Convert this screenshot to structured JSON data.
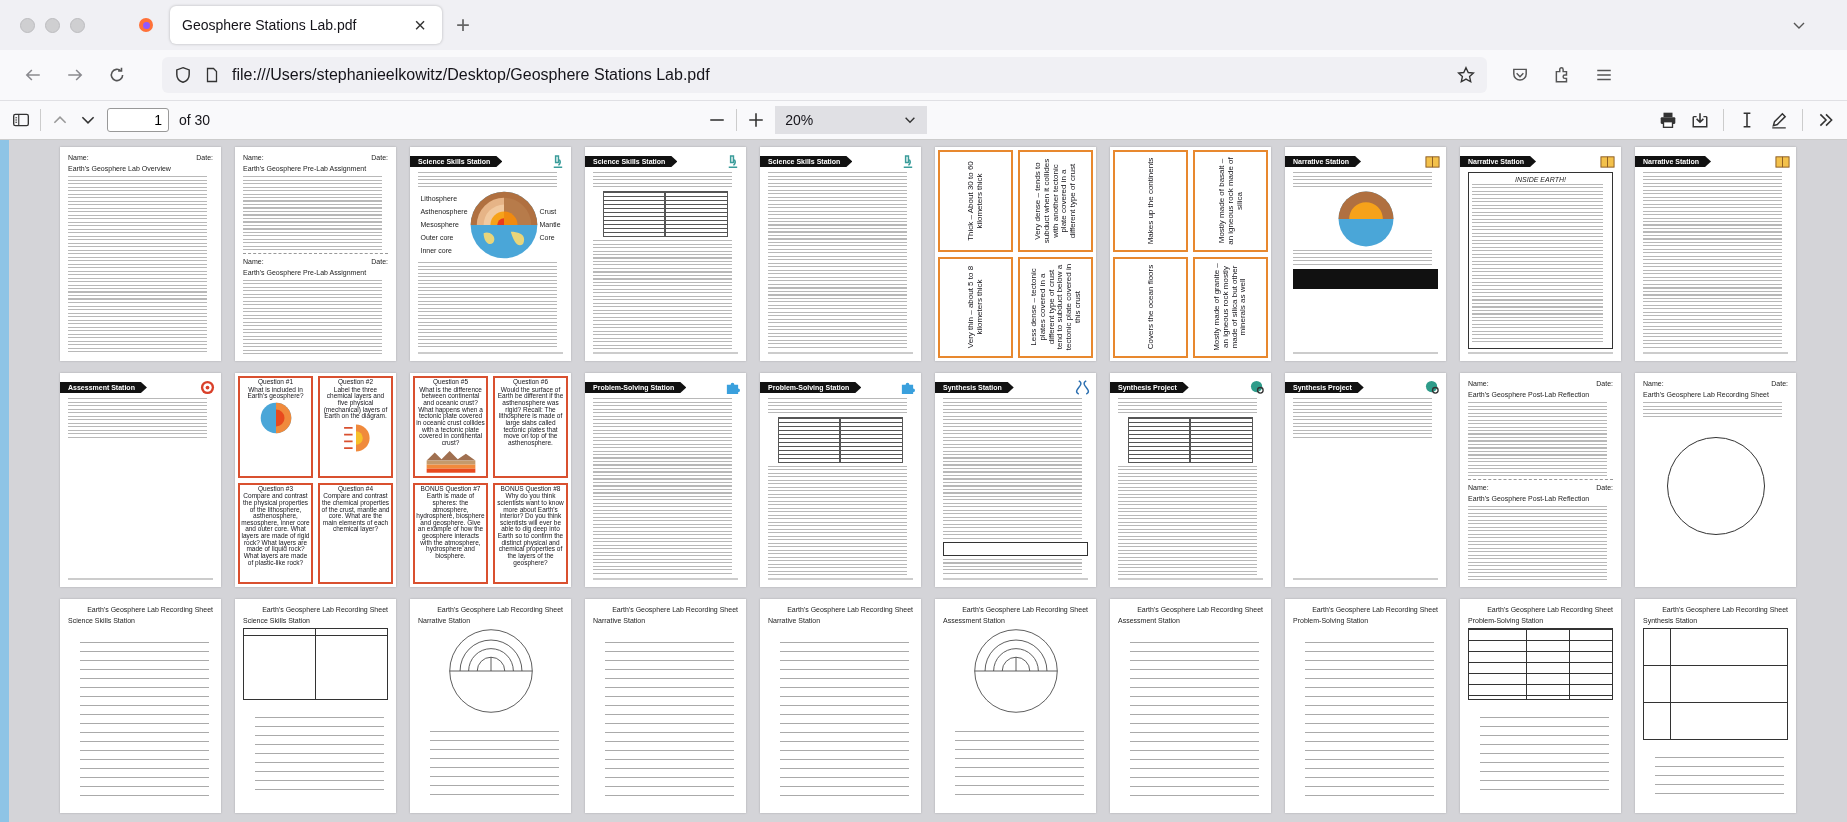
{
  "tab": {
    "title": "Geosphere Stations Lab.pdf",
    "close": "×",
    "new_tab": "+"
  },
  "address": {
    "url": "file:///Users/stephanieelkowitz/Desktop/Geosphere Stations Lab.pdf"
  },
  "pdf_toolbar": {
    "page_number": "1",
    "page_count": "of 30",
    "zoom": "20%"
  },
  "pages": [
    {
      "kind": "doc",
      "sections": [
        {
          "name_label": "Name:",
          "date_label": "Date:",
          "title": "Earth's Geosphere Lab Overview"
        }
      ]
    },
    {
      "kind": "doc",
      "sections": [
        {
          "name_label": "Name:",
          "date_label": "Date:",
          "title": "Earth's Geosphere Pre-Lab Assignment"
        },
        {
          "name_label": "Name:",
          "date_label": "Date:",
          "title": "Earth's Geosphere Pre-Lab Assignment"
        }
      ]
    },
    {
      "kind": "station",
      "title": "Science Skills Station",
      "badge": {
        "kind": "science"
      },
      "figure": {
        "kind": "earth-layers",
        "left_labels": [
          "Lithosphere",
          "Asthenosphere",
          "Mesosphere",
          "Outer core",
          "Inner core"
        ],
        "right_labels": [
          "Crust",
          "Mantle",
          "Core"
        ]
      }
    },
    {
      "kind": "station",
      "title": "Science Skills Station",
      "badge": {
        "kind": "science"
      },
      "figure": {
        "kind": "table"
      }
    },
    {
      "kind": "station",
      "title": "Science Skills Station",
      "badge": {
        "kind": "science"
      },
      "figure": {
        "kind": "text"
      }
    },
    {
      "kind": "cards",
      "cards": [
        {
          "text": "Thick – About 30 to 60 kilometers thick",
          "color": "#e8882e"
        },
        {
          "text": "Very dense – tends to subduct when it collides with another tectonic plate covered in a different type of crust",
          "color": "#e8882e"
        },
        {
          "text": "Very thin – about 5 to 8 kilometers thick",
          "color": "#e8882e"
        },
        {
          "text": "Less dense – tectonic plates covered in a different type of crust tend to subduct below a tectonic plate covered in this crust",
          "color": "#e8882e"
        }
      ]
    },
    {
      "kind": "cards",
      "cards": [
        {
          "text": "Makes up the continents",
          "color": "#e8882e"
        },
        {
          "text": "Mostly made of basalt – an igneous rock made of silica",
          "color": "#e8882e"
        },
        {
          "text": "Covers the ocean floors",
          "color": "#e8882e"
        },
        {
          "text": "Mostly made of granite – an igneous rock mostly made of silica but other minerals as well",
          "color": "#e8882e"
        }
      ]
    },
    {
      "kind": "station",
      "title": "Narrative Station",
      "badge": {
        "kind": "narrative"
      },
      "figure": {
        "kind": "small-layers"
      }
    },
    {
      "kind": "station",
      "title": "Narrative Station",
      "badge": {
        "kind": "narrative"
      },
      "figure": {
        "kind": "boxed",
        "box_title": "INSIDE EARTH!"
      }
    },
    {
      "kind": "station",
      "title": "Narrative Station",
      "badge": {
        "kind": "narrative"
      },
      "figure": {
        "kind": "text"
      }
    },
    {
      "kind": "station",
      "title": "Assessment Station",
      "badge": {
        "kind": "assessment"
      },
      "figure": {
        "kind": "short"
      }
    },
    {
      "kind": "questions",
      "cards": [
        {
          "heading": "Question #1",
          "text": "What is included in Earth's geosphere?",
          "color": "#d9502f",
          "picture": {
            "kind": "globe"
          }
        },
        {
          "heading": "Question #2",
          "text": "Label the three chemical layers and five physical (mechanical) layers of Earth on the diagram.",
          "color": "#d9502f",
          "picture": {
            "kind": "layers"
          }
        },
        {
          "heading": "Question #3",
          "text": "Compare and contrast the physical properties of the lithosphere, asthenosphere, mesosphere, inner core and outer core. What layers are made of rigid rock? What layers are made of liquid rock? What layers are made of plastic-like rock?",
          "color": "#d9502f"
        },
        {
          "heading": "Question #4",
          "text": "Compare and contrast the chemical properties of the crust, mantle and core. What are the main elements of each chemical layer?",
          "color": "#d9502f"
        }
      ]
    },
    {
      "kind": "questions",
      "cards": [
        {
          "heading": "Question #5",
          "text": "What is the difference between continental and oceanic crust? What happens when a tectonic plate covered in oceanic crust collides with a tectonic plate covered in continental crust?",
          "color": "#d9502f",
          "picture": {
            "kind": "landscape"
          }
        },
        {
          "heading": "Question #6",
          "text": "Would the surface of Earth be different if the asthenosphere was rigid? Recall: The lithosphere is made of large slabs called tectonic plates that move on top of the asthenosphere.",
          "color": "#d9502f"
        },
        {
          "heading": "BONUS Question #7",
          "text": "Earth is made of spheres: the atmosphere, hydrosphere, biosphere and geosphere. Give an example of how the geosphere interacts with the atmosphere, hydrosphere and biosphere.",
          "color": "#d9502f"
        },
        {
          "heading": "BONUS Question #8",
          "text": "Why do you think scientists want to know more about Earth's interior? Do you think scientists will ever be able to dig deep into Earth so to confirm the distinct physical and chemical properties of the layers of the geosphere?",
          "color": "#d9502f"
        }
      ]
    },
    {
      "kind": "station",
      "title": "Problem-Solving Station",
      "badge": {
        "kind": "problem"
      },
      "figure": {
        "kind": "text"
      }
    },
    {
      "kind": "station",
      "title": "Problem-Solving Station",
      "badge": {
        "kind": "problem"
      },
      "figure": {
        "kind": "table"
      }
    },
    {
      "kind": "station",
      "title": "Synthesis Station",
      "badge": {
        "kind": "synthesis"
      },
      "figure": {
        "kind": "claim"
      }
    },
    {
      "kind": "station",
      "title": "Synthesis Project",
      "badge": {
        "kind": "project"
      },
      "figure": {
        "kind": "table"
      }
    },
    {
      "kind": "station",
      "title": "Synthesis Project",
      "badge": {
        "kind": "project"
      },
      "figure": {
        "kind": "short"
      }
    },
    {
      "kind": "doc",
      "sections": [
        {
          "name_label": "Name:",
          "date_label": "Date:",
          "title": "Earth's Geosphere Post-Lab Reflection"
        },
        {
          "name_label": "Name:",
          "date_label": "Date:",
          "title": "Earth's Geosphere Post-Lab Reflection"
        }
      ]
    },
    {
      "kind": "circle-doc",
      "sections": [
        {
          "name_label": "Name:",
          "date_label": "Date:",
          "title": "Earth's Geosphere Lab Recording Sheet"
        }
      ]
    },
    {
      "kind": "recording",
      "header": "Earth's Geosphere Lab Recording Sheet",
      "station_title": "Science Skills Station",
      "figure": {
        "kind": "lines"
      }
    },
    {
      "kind": "recording",
      "header": "Earth's Geosphere Lab Recording Sheet",
      "station_title": "Science Skills Station",
      "figure": {
        "kind": "two-column"
      }
    },
    {
      "kind": "recording",
      "header": "Earth's Geosphere Lab Recording Sheet",
      "station_title": "Narrative Station",
      "figure": {
        "kind": "semicircle"
      }
    },
    {
      "kind": "recording",
      "header": "Earth's Geosphere Lab Recording Sheet",
      "station_title": "Narrative Station",
      "figure": {
        "kind": "lines"
      }
    },
    {
      "kind": "recording",
      "header": "Earth's Geosphere Lab Recording Sheet",
      "station_title": "Narrative Station",
      "figure": {
        "kind": "lines"
      }
    },
    {
      "kind": "recording",
      "header": "Earth's Geosphere Lab Recording Sheet",
      "station_title": "Assessment Station",
      "figure": {
        "kind": "semicircle"
      }
    },
    {
      "kind": "recording",
      "header": "Earth's Geosphere Lab Recording Sheet",
      "station_title": "Assessment Station",
      "figure": {
        "kind": "lines"
      }
    },
    {
      "kind": "recording",
      "header": "Earth's Geosphere Lab Recording Sheet",
      "station_title": "Problem-Solving Station",
      "figure": {
        "kind": "lines"
      }
    },
    {
      "kind": "recording",
      "header": "Earth's Geosphere Lab Recording Sheet",
      "station_title": "Problem-Solving Station",
      "figure": {
        "kind": "table"
      }
    },
    {
      "kind": "recording",
      "header": "Earth's Geosphere Lab Recording Sheet",
      "station_title": "Synthesis Station",
      "figure": {
        "kind": "boxes"
      }
    }
  ]
}
